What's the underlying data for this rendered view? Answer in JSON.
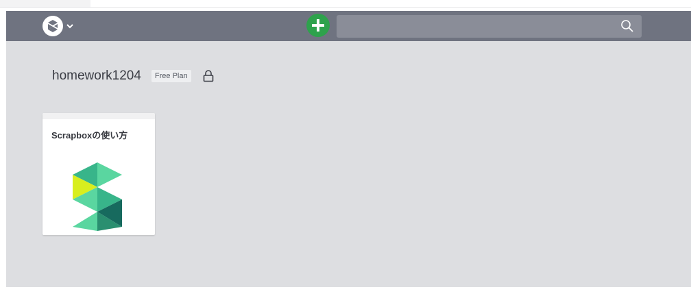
{
  "navbar": {
    "brand_icon": "scrapbox-logo-icon",
    "menu_icon": "chevron-down-icon",
    "add_icon": "plus-icon",
    "search": {
      "value": "",
      "placeholder": "",
      "icon": "search-icon"
    }
  },
  "project": {
    "title": "homework1204",
    "plan_badge": "Free Plan",
    "privacy_icon": "lock-icon"
  },
  "pages": [
    {
      "title": "Scrapboxの使い方",
      "thumbnail": "scrapbox-s-logo"
    }
  ],
  "colors": {
    "navbar": "#6f7380",
    "search_bg": "#8a8d98",
    "add_button": "#2ea24c",
    "main_bg": "#dddee1",
    "logo_green_light": "#5ad6a0",
    "logo_green_mid": "#38b58a",
    "logo_green_dark": "#176a5e",
    "logo_yellow": "#d8ee1e"
  }
}
